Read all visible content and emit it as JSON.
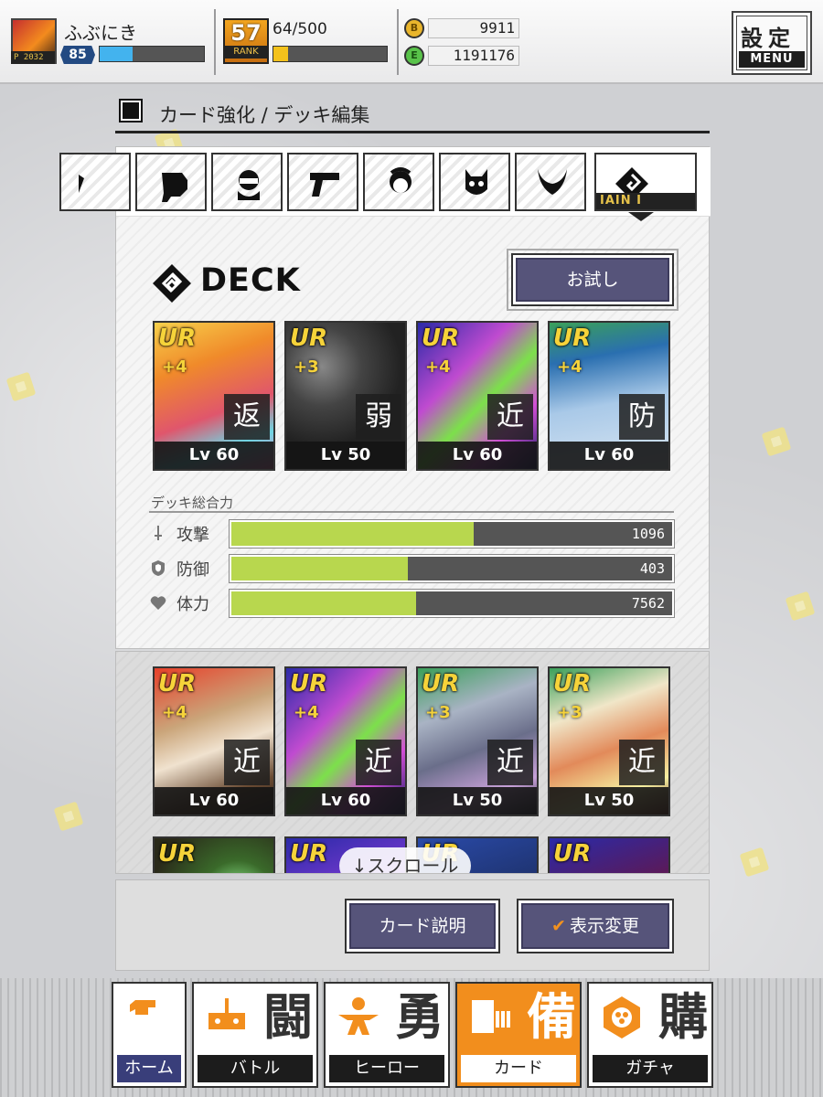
{
  "header": {
    "username": "ふぶにき",
    "player_level": "85",
    "exp_fraction": 0.32,
    "rank": "57",
    "rank_label": "RANK",
    "stamina_text": "64/500",
    "stamina_fraction": 0.128,
    "currency_b_icon": "B",
    "currency_b": "9911",
    "currency_e_icon": "E",
    "currency_e": "1191176",
    "settings_label": "設定",
    "menu_label": "MENU"
  },
  "page_title": "カード強化 / デッキ編集",
  "tabs": [
    {
      "icon": "partial-tab-icon",
      "label": ""
    },
    {
      "icon": "fist-icon",
      "label": ""
    },
    {
      "icon": "masked-face-icon",
      "label": ""
    },
    {
      "icon": "gun-icon",
      "label": ""
    },
    {
      "icon": "girl-face-icon",
      "label": ""
    },
    {
      "icon": "demon-face-icon",
      "label": ""
    },
    {
      "icon": "horned-mask-icon",
      "label": ""
    },
    {
      "icon": "deck-logo-icon",
      "label": "IAIN I",
      "active": true
    }
  ],
  "deck": {
    "title": "DECK",
    "try_button": "お試し",
    "cards": [
      {
        "rarity": "UR",
        "plus": "+4",
        "type": "返",
        "level": "Lv 60",
        "art": "orange-pink"
      },
      {
        "rarity": "UR",
        "plus": "+3",
        "type": "弱",
        "level": "Lv 50",
        "art": "grey-skulls"
      },
      {
        "rarity": "UR",
        "plus": "+4",
        "type": "近",
        "level": "Lv 60",
        "art": "green-purple"
      },
      {
        "rarity": "UR",
        "plus": "+4",
        "type": "防",
        "level": "Lv 60",
        "art": "blue-city"
      }
    ]
  },
  "stats": {
    "title": "デッキ総合力",
    "rows": [
      {
        "icon": "sword-icon",
        "label": "攻撃",
        "value": "1096",
        "fraction": 0.55
      },
      {
        "icon": "shield-icon",
        "label": "防御",
        "value": "403",
        "fraction": 0.4
      },
      {
        "icon": "heart-icon",
        "label": "体力",
        "value": "7562",
        "fraction": 0.42
      }
    ]
  },
  "card_list": {
    "cards": [
      {
        "rarity": "UR",
        "plus": "+4",
        "type": "近",
        "level": "Lv 60",
        "art": "brown-smoke"
      },
      {
        "rarity": "UR",
        "plus": "+4",
        "type": "近",
        "level": "Lv 60",
        "art": "green-purple"
      },
      {
        "rarity": "UR",
        "plus": "+3",
        "type": "近",
        "level": "Lv 50",
        "art": "grey-dragon"
      },
      {
        "rarity": "UR",
        "plus": "+3",
        "type": "近",
        "level": "Lv 50",
        "art": "bird-flame"
      },
      {
        "rarity": "UR",
        "plus": "",
        "type": "",
        "level": "",
        "art": "dark-green"
      },
      {
        "rarity": "UR",
        "plus": "",
        "type": "",
        "level": "",
        "art": "purple-dark"
      },
      {
        "rarity": "UR",
        "plus": "",
        "type": "",
        "level": "",
        "art": "blue-night"
      },
      {
        "rarity": "UR",
        "plus": "",
        "type": "",
        "level": "",
        "art": "magenta-beast"
      }
    ],
    "scroll_hint": "↓スクロール"
  },
  "actions": {
    "card_description": "カード説明",
    "change_view_check": "✔",
    "change_view": "表示変更"
  },
  "nav": [
    {
      "id": "home",
      "big": "",
      "label": "ホーム"
    },
    {
      "id": "battle",
      "big": "闘",
      "label": "バトル"
    },
    {
      "id": "hero",
      "big": "勇",
      "label": "ヒーロー"
    },
    {
      "id": "card",
      "big": "備",
      "label": "カード",
      "active": true
    },
    {
      "id": "gacha",
      "big": "購",
      "label": "ガチャ"
    }
  ],
  "colors": {
    "accent_orange": "#f28e1d",
    "button_purple": "#56547a",
    "stat_bar": "#b8d74e",
    "exp_bar": "#43b3ee",
    "stamina_bar": "#f4c21c"
  }
}
